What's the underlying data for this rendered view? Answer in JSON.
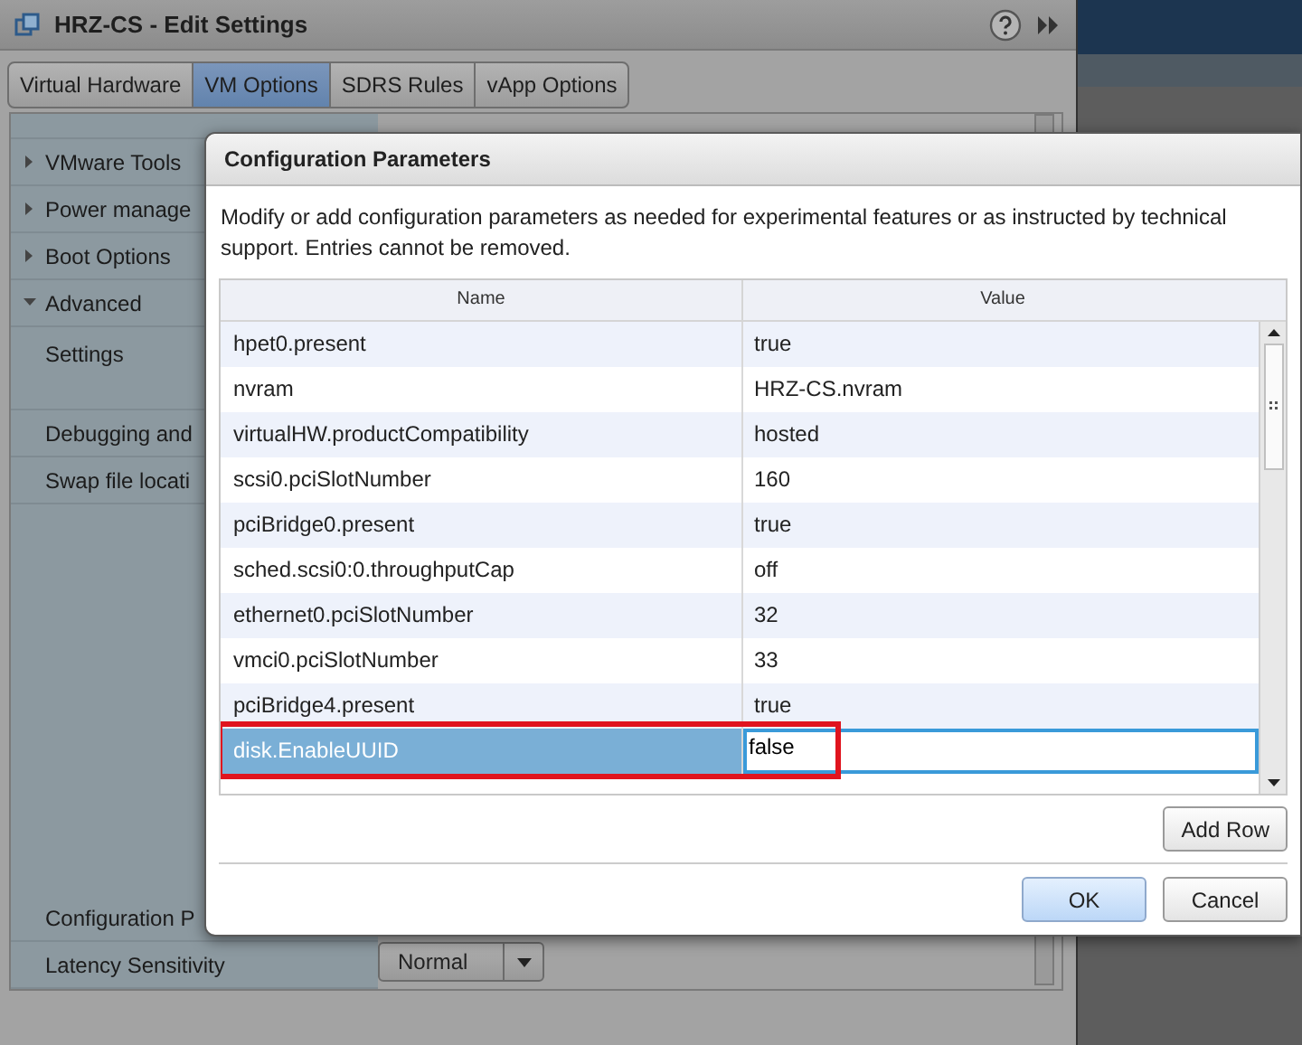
{
  "window": {
    "title": "HRZ-CS - Edit Settings"
  },
  "tabs": [
    {
      "label": "Virtual Hardware",
      "selected": false
    },
    {
      "label": "VM Options",
      "selected": true
    },
    {
      "label": "SDRS Rules",
      "selected": false
    },
    {
      "label": "vApp Options",
      "selected": false
    }
  ],
  "settings_tree": [
    {
      "label": "VMware Tools",
      "kind": "section",
      "expanded": false
    },
    {
      "label": "Power manage",
      "kind": "section",
      "expanded": false
    },
    {
      "label": "Boot Options",
      "kind": "section",
      "expanded": false
    },
    {
      "label": "Advanced",
      "kind": "section",
      "expanded": true,
      "children": [
        {
          "label": "Settings"
        },
        {
          "label": "Debugging and"
        },
        {
          "label": "Swap file locati"
        },
        {
          "label": "Configuration P"
        },
        {
          "label": "Latency Sensitivity"
        }
      ]
    }
  ],
  "settings_values": {
    "latency_select": "Normal"
  },
  "dialog": {
    "title": "Configuration Parameters",
    "description": "Modify or add configuration parameters as needed for experimental features or as instructed by technical support. Entries cannot be removed.",
    "columns": [
      "Name",
      "Value"
    ],
    "rows": [
      {
        "name": "hpet0.present",
        "value": "true",
        "selected": false,
        "highlighted": false
      },
      {
        "name": "nvram",
        "value": "HRZ-CS.nvram",
        "selected": false,
        "highlighted": false
      },
      {
        "name": "virtualHW.productCompatibility",
        "value": "hosted",
        "selected": false,
        "highlighted": false
      },
      {
        "name": "scsi0.pciSlotNumber",
        "value": "160",
        "selected": false,
        "highlighted": false
      },
      {
        "name": "pciBridge0.present",
        "value": "true",
        "selected": false,
        "highlighted": false
      },
      {
        "name": "sched.scsi0:0.throughputCap",
        "value": "off",
        "selected": false,
        "highlighted": false
      },
      {
        "name": "ethernet0.pciSlotNumber",
        "value": "32",
        "selected": false,
        "highlighted": false
      },
      {
        "name": "vmci0.pciSlotNumber",
        "value": "33",
        "selected": false,
        "highlighted": false
      },
      {
        "name": "pciBridge4.present",
        "value": "true",
        "selected": false,
        "highlighted": false
      },
      {
        "name": "disk.EnableUUID",
        "value": "false",
        "selected": true,
        "highlighted": true
      }
    ],
    "add_button": "Add Row",
    "buttons": [
      {
        "label": "OK",
        "kind": "primary"
      },
      {
        "label": "Cancel",
        "kind": "secondary"
      }
    ]
  }
}
